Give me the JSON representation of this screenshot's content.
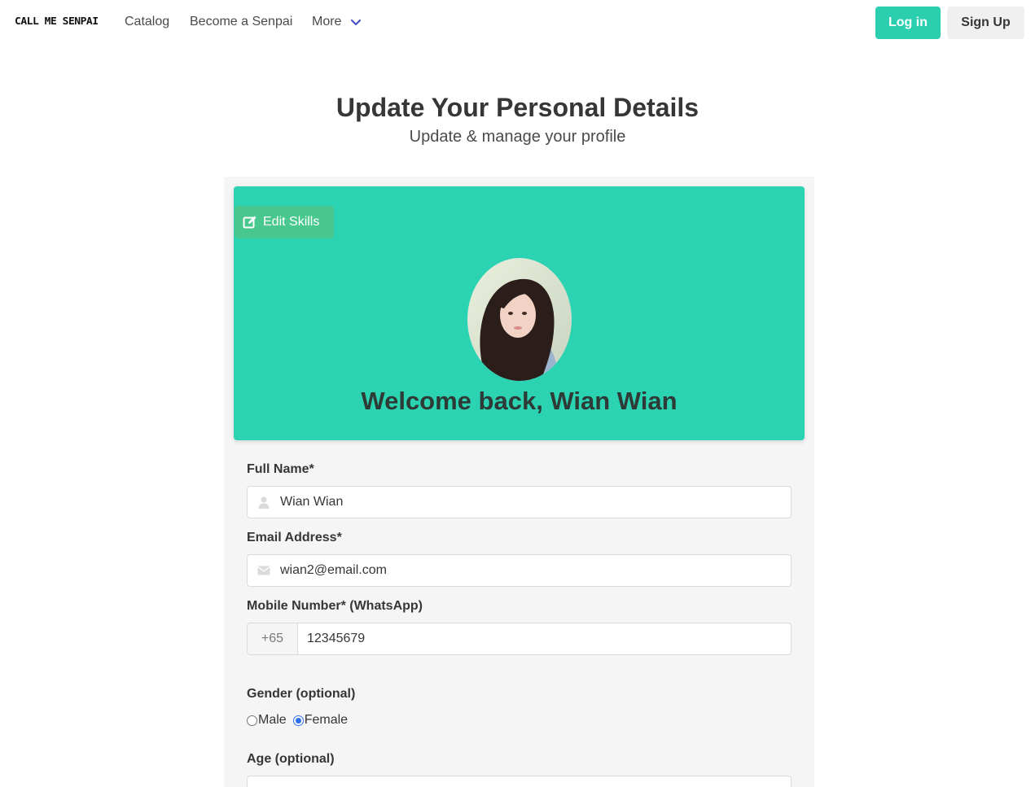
{
  "nav": {
    "brand": "CALL ME SENPAI",
    "links": [
      "Catalog",
      "Become a Senpai",
      "More"
    ],
    "login": "Log in",
    "signup": "Sign Up"
  },
  "header": {
    "title": "Update Your Personal Details",
    "subtitle": "Update & manage your profile"
  },
  "hero": {
    "edit_skills": "Edit Skills",
    "welcome": "Welcome back, Wian Wian"
  },
  "form": {
    "full_name_label": "Full Name*",
    "full_name_value": "Wian Wian",
    "email_label": "Email Address*",
    "email_value": "wian2@email.com",
    "mobile_label": "Mobile Number* (WhatsApp)",
    "mobile_prefix": "+65",
    "mobile_value": "12345679",
    "gender_label": "Gender (optional)",
    "gender_options": [
      "Male",
      "Female"
    ],
    "gender_selected": "Female",
    "age_label": "Age (optional)"
  },
  "colors": {
    "accent": "#2bcfb0",
    "hero_bg": "#2bd3b3",
    "edit_button": "#48c78e"
  },
  "icons": {
    "more_dropdown": "chevron-down-icon",
    "edit_skills": "edit-icon",
    "full_name": "user-icon",
    "email": "envelope-icon"
  }
}
